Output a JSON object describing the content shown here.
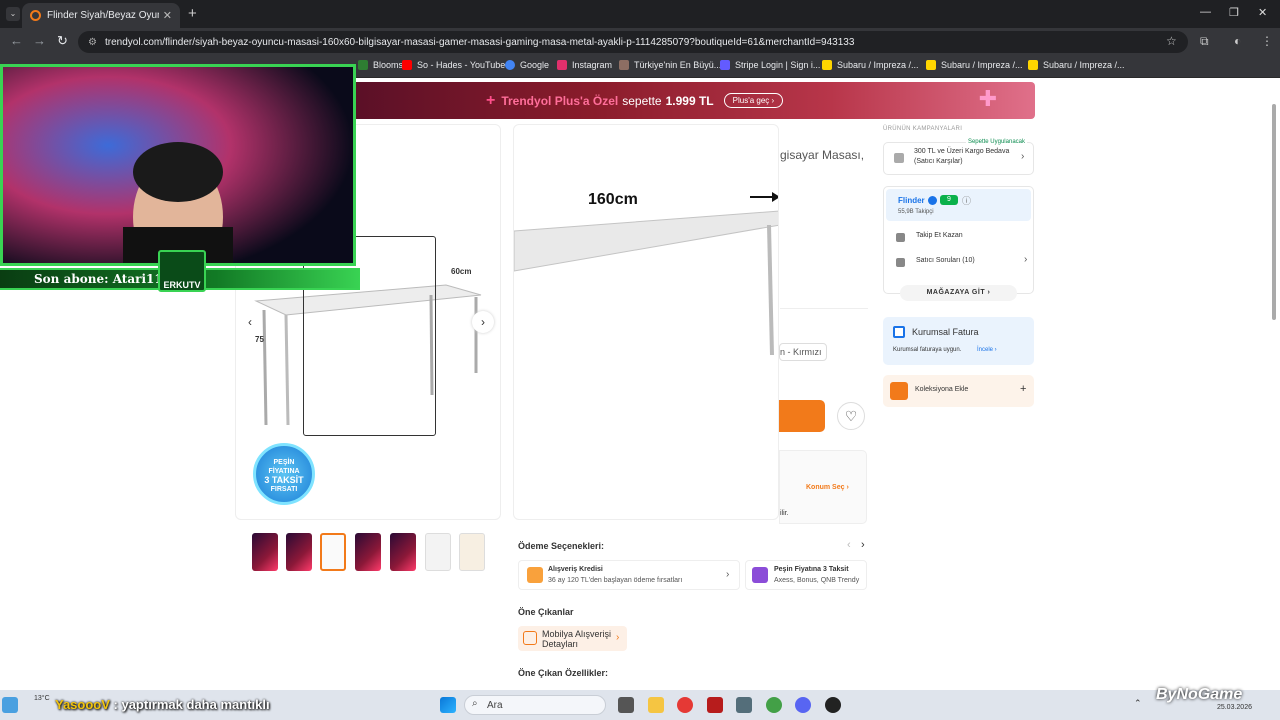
{
  "browser": {
    "tab_title": "Flinder Siyah/Beyaz Oyuncu Ma",
    "url": "trendyol.com/flinder/siyah-beyaz-oyuncu-masasi-160x60-bilgisayar-masasi-gamer-masasi-gaming-masa-metal-ayakli-p-1114285079?boutiqueId=61&merchantId=943133",
    "bookmarks": [
      {
        "label": "Blooms...",
        "color": "#2e7d32"
      },
      {
        "label": "So - Hades - YouTube",
        "color": "#ff0000"
      },
      {
        "label": "Google",
        "color": "#4285f4"
      },
      {
        "label": "Instagram",
        "color": "#e1306c"
      },
      {
        "label": "Türkiye'nin En Büyü...",
        "color": "#8d6e63"
      },
      {
        "label": "Stripe Login | Sign i...",
        "color": "#635bff"
      },
      {
        "label": "Subaru / Impreza /...",
        "color": "#ffd600"
      },
      {
        "label": "Subaru / Impreza /...",
        "color": "#ffd600"
      },
      {
        "label": "Subaru / Impreza /...",
        "color": "#ffd600"
      }
    ]
  },
  "banner": {
    "brand": "Trendyol Plus'a Özel",
    "text": "sepette",
    "price": "1.999 TL",
    "button": "Plus'a geç"
  },
  "product": {
    "title_partial": "gisayar Masası,",
    "dimension_160": "160cm",
    "dimension_60": "60cm",
    "dimension_75": "75",
    "color_partial": "n - Kırmızı",
    "badge_line1": "PEŞİN",
    "badge_line2": "FİYATINA",
    "badge_line3": "3 TAKSİT",
    "badge_line4": "FIRSATI",
    "konum": "Konum Seç",
    "konum_note": "ilir."
  },
  "payment": {
    "heading": "Ödeme Seçenekleri:",
    "option1_title": "Alışveriş Kredisi",
    "option1_sub": "36 ay 120 TL'den başlayan ödeme fırsatları",
    "option2_title": "Peşin Fiyatına 3 Taksit",
    "option2_sub": "Axess, Bonus, QNB Trendy"
  },
  "highlights": {
    "heading": "Öne Çıkanlar",
    "item": "Mobilya Alışverişi Detayları",
    "features_heading": "Öne Çıkan Özellikler:"
  },
  "sidebar": {
    "campaigns_heading": "ÜRÜNÜN KAMPANYALARI",
    "campaign_tag": "Sepette Uygulanacak",
    "campaign_text1": "300 TL ve Üzeri Kargo Bedava",
    "campaign_text2": "(Satıcı Karşılar)",
    "seller_name": "Flinder",
    "seller_rating": "9",
    "seller_followers": "55,9B Takipçi",
    "follow_earn": "Takip Et Kazan",
    "seller_questions": "Satıcı Soruları (10)",
    "store_button": "MAĞAZAYA GİT",
    "corp_title": "Kurumsal Fatura",
    "corp_sub": "Kurumsal faturaya uygun.",
    "corp_link": "İncele",
    "collection": "Koleksiyona Ekle"
  },
  "stream": {
    "sub_text": "Son abone: Atari11",
    "erk_label": "ERKUTV",
    "chat_user": "YasoooV",
    "chat_msg": " : yaptırmak daha mantıklı"
  },
  "taskbar": {
    "search_placeholder": "Ara",
    "weather": "13°C",
    "date": "25.03.2026",
    "watermark": "ByNoGame"
  }
}
